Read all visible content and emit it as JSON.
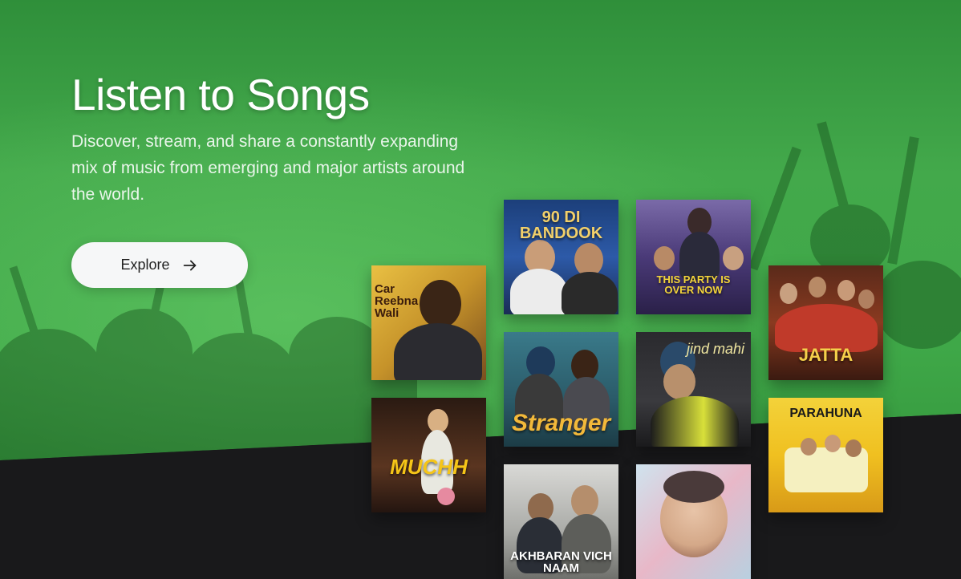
{
  "hero": {
    "title": "Listen to Songs",
    "subtitle": "Discover, stream, and share a constantly expanding mix of music from emerging and major artists around the world.",
    "explore_label": "Explore"
  },
  "albums": [
    {
      "id": "car-reebna-wali",
      "label": "Car Reebna Wali"
    },
    {
      "id": "muchh",
      "label": "MUCHH"
    },
    {
      "id": "90-di-bandook",
      "label": "90 DI BANDOOK"
    },
    {
      "id": "stranger",
      "label": "Stranger"
    },
    {
      "id": "akhbaran-vich-naam",
      "label": "AKHBARAN VICH NAAM"
    },
    {
      "id": "this-party-is-over-now",
      "label": "THIS PARTY IS OVER NOW"
    },
    {
      "id": "jind-mahi",
      "label": "jind mahi"
    },
    {
      "id": "album-portrait",
      "label": ""
    },
    {
      "id": "jatt-jaata",
      "label": "JATTA"
    },
    {
      "id": "parahuna",
      "label": "PARAHUNA"
    }
  ],
  "colors": {
    "hero_green": "#43a94b",
    "dark_band": "#19191b",
    "button_bg": "#f6f7f8"
  },
  "icons": {
    "explore_arrow": "arrow-right-icon"
  }
}
